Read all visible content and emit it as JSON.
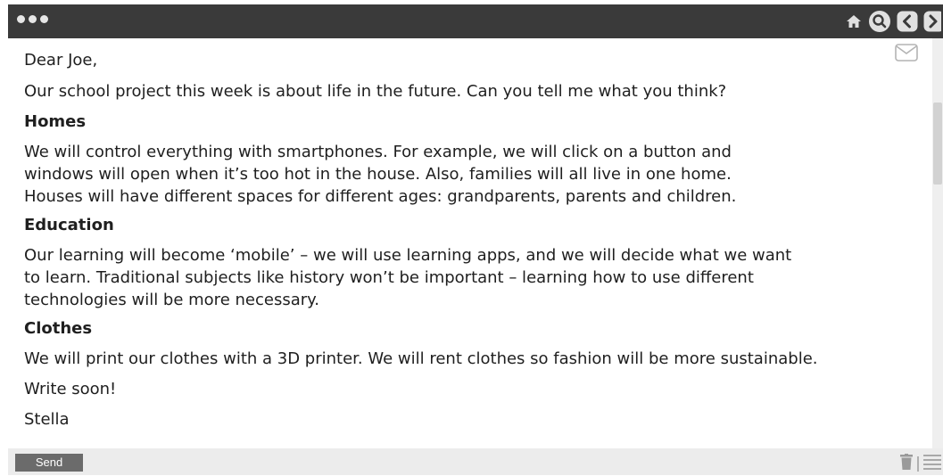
{
  "window": {
    "nav_icons": [
      "home-icon",
      "search-icon",
      "back-icon",
      "forward-icon"
    ]
  },
  "letter": {
    "greeting": "Dear Joe,",
    "intro": "Our school project this week is about life in the future. Can you tell me what you think?",
    "sections": [
      {
        "heading": "Homes",
        "lines": [
          "We will control everything with smartphones. For example, we will click on a button and",
          "windows will open when it’s too hot in the house. Also, families will all live in one home.",
          "Houses will have different spaces for different ages: grandparents, parents and children."
        ]
      },
      {
        "heading": "Education",
        "lines": [
          "Our learning will become ‘mobile’ – we will use learning apps, and we will decide what we want",
          "to learn. Traditional subjects like history won’t be important – learning how to use different",
          "technologies will be more necessary."
        ]
      },
      {
        "heading": "Clothes",
        "lines": [
          "We will print our clothes with a 3D printer. We will rent clothes so fashion will be more sustainable."
        ]
      }
    ],
    "closing": "Write soon!",
    "signature": "Stella"
  },
  "footer": {
    "send_label": "Send",
    "icons": [
      "trash-icon",
      "menu-icon"
    ]
  },
  "colors": {
    "titlebar": "#3a3a3a",
    "send_button": "#6b6b6b",
    "bottombar": "#ececec"
  }
}
